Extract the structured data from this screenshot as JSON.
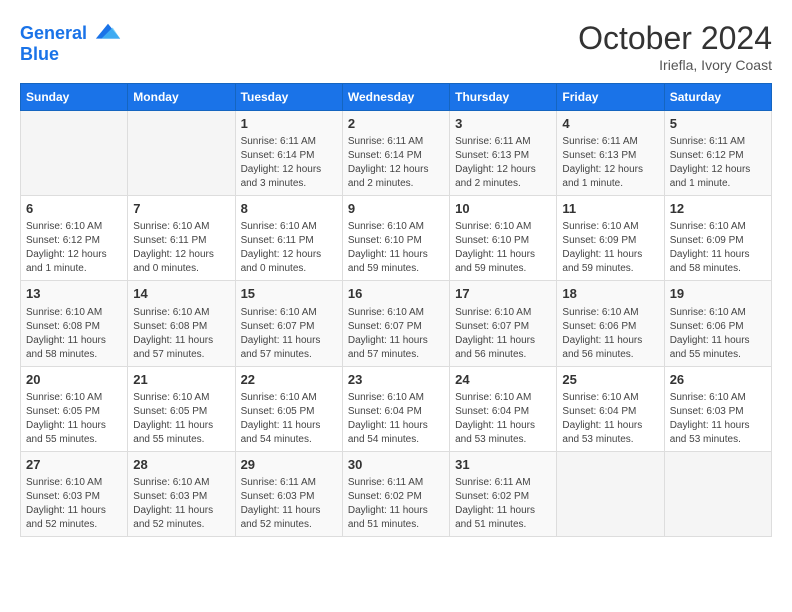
{
  "header": {
    "logo_line1": "General",
    "logo_line2": "Blue",
    "month": "October 2024",
    "location": "Iriefla, Ivory Coast"
  },
  "weekdays": [
    "Sunday",
    "Monday",
    "Tuesday",
    "Wednesday",
    "Thursday",
    "Friday",
    "Saturday"
  ],
  "weeks": [
    [
      {
        "day": "",
        "sunrise": "",
        "sunset": "",
        "daylight": ""
      },
      {
        "day": "",
        "sunrise": "",
        "sunset": "",
        "daylight": ""
      },
      {
        "day": "1",
        "sunrise": "Sunrise: 6:11 AM",
        "sunset": "Sunset: 6:14 PM",
        "daylight": "Daylight: 12 hours and 3 minutes."
      },
      {
        "day": "2",
        "sunrise": "Sunrise: 6:11 AM",
        "sunset": "Sunset: 6:14 PM",
        "daylight": "Daylight: 12 hours and 2 minutes."
      },
      {
        "day": "3",
        "sunrise": "Sunrise: 6:11 AM",
        "sunset": "Sunset: 6:13 PM",
        "daylight": "Daylight: 12 hours and 2 minutes."
      },
      {
        "day": "4",
        "sunrise": "Sunrise: 6:11 AM",
        "sunset": "Sunset: 6:13 PM",
        "daylight": "Daylight: 12 hours and 1 minute."
      },
      {
        "day": "5",
        "sunrise": "Sunrise: 6:11 AM",
        "sunset": "Sunset: 6:12 PM",
        "daylight": "Daylight: 12 hours and 1 minute."
      }
    ],
    [
      {
        "day": "6",
        "sunrise": "Sunrise: 6:10 AM",
        "sunset": "Sunset: 6:12 PM",
        "daylight": "Daylight: 12 hours and 1 minute."
      },
      {
        "day": "7",
        "sunrise": "Sunrise: 6:10 AM",
        "sunset": "Sunset: 6:11 PM",
        "daylight": "Daylight: 12 hours and 0 minutes."
      },
      {
        "day": "8",
        "sunrise": "Sunrise: 6:10 AM",
        "sunset": "Sunset: 6:11 PM",
        "daylight": "Daylight: 12 hours and 0 minutes."
      },
      {
        "day": "9",
        "sunrise": "Sunrise: 6:10 AM",
        "sunset": "Sunset: 6:10 PM",
        "daylight": "Daylight: 11 hours and 59 minutes."
      },
      {
        "day": "10",
        "sunrise": "Sunrise: 6:10 AM",
        "sunset": "Sunset: 6:10 PM",
        "daylight": "Daylight: 11 hours and 59 minutes."
      },
      {
        "day": "11",
        "sunrise": "Sunrise: 6:10 AM",
        "sunset": "Sunset: 6:09 PM",
        "daylight": "Daylight: 11 hours and 59 minutes."
      },
      {
        "day": "12",
        "sunrise": "Sunrise: 6:10 AM",
        "sunset": "Sunset: 6:09 PM",
        "daylight": "Daylight: 11 hours and 58 minutes."
      }
    ],
    [
      {
        "day": "13",
        "sunrise": "Sunrise: 6:10 AM",
        "sunset": "Sunset: 6:08 PM",
        "daylight": "Daylight: 11 hours and 58 minutes."
      },
      {
        "day": "14",
        "sunrise": "Sunrise: 6:10 AM",
        "sunset": "Sunset: 6:08 PM",
        "daylight": "Daylight: 11 hours and 57 minutes."
      },
      {
        "day": "15",
        "sunrise": "Sunrise: 6:10 AM",
        "sunset": "Sunset: 6:07 PM",
        "daylight": "Daylight: 11 hours and 57 minutes."
      },
      {
        "day": "16",
        "sunrise": "Sunrise: 6:10 AM",
        "sunset": "Sunset: 6:07 PM",
        "daylight": "Daylight: 11 hours and 57 minutes."
      },
      {
        "day": "17",
        "sunrise": "Sunrise: 6:10 AM",
        "sunset": "Sunset: 6:07 PM",
        "daylight": "Daylight: 11 hours and 56 minutes."
      },
      {
        "day": "18",
        "sunrise": "Sunrise: 6:10 AM",
        "sunset": "Sunset: 6:06 PM",
        "daylight": "Daylight: 11 hours and 56 minutes."
      },
      {
        "day": "19",
        "sunrise": "Sunrise: 6:10 AM",
        "sunset": "Sunset: 6:06 PM",
        "daylight": "Daylight: 11 hours and 55 minutes."
      }
    ],
    [
      {
        "day": "20",
        "sunrise": "Sunrise: 6:10 AM",
        "sunset": "Sunset: 6:05 PM",
        "daylight": "Daylight: 11 hours and 55 minutes."
      },
      {
        "day": "21",
        "sunrise": "Sunrise: 6:10 AM",
        "sunset": "Sunset: 6:05 PM",
        "daylight": "Daylight: 11 hours and 55 minutes."
      },
      {
        "day": "22",
        "sunrise": "Sunrise: 6:10 AM",
        "sunset": "Sunset: 6:05 PM",
        "daylight": "Daylight: 11 hours and 54 minutes."
      },
      {
        "day": "23",
        "sunrise": "Sunrise: 6:10 AM",
        "sunset": "Sunset: 6:04 PM",
        "daylight": "Daylight: 11 hours and 54 minutes."
      },
      {
        "day": "24",
        "sunrise": "Sunrise: 6:10 AM",
        "sunset": "Sunset: 6:04 PM",
        "daylight": "Daylight: 11 hours and 53 minutes."
      },
      {
        "day": "25",
        "sunrise": "Sunrise: 6:10 AM",
        "sunset": "Sunset: 6:04 PM",
        "daylight": "Daylight: 11 hours and 53 minutes."
      },
      {
        "day": "26",
        "sunrise": "Sunrise: 6:10 AM",
        "sunset": "Sunset: 6:03 PM",
        "daylight": "Daylight: 11 hours and 53 minutes."
      }
    ],
    [
      {
        "day": "27",
        "sunrise": "Sunrise: 6:10 AM",
        "sunset": "Sunset: 6:03 PM",
        "daylight": "Daylight: 11 hours and 52 minutes."
      },
      {
        "day": "28",
        "sunrise": "Sunrise: 6:10 AM",
        "sunset": "Sunset: 6:03 PM",
        "daylight": "Daylight: 11 hours and 52 minutes."
      },
      {
        "day": "29",
        "sunrise": "Sunrise: 6:11 AM",
        "sunset": "Sunset: 6:03 PM",
        "daylight": "Daylight: 11 hours and 52 minutes."
      },
      {
        "day": "30",
        "sunrise": "Sunrise: 6:11 AM",
        "sunset": "Sunset: 6:02 PM",
        "daylight": "Daylight: 11 hours and 51 minutes."
      },
      {
        "day": "31",
        "sunrise": "Sunrise: 6:11 AM",
        "sunset": "Sunset: 6:02 PM",
        "daylight": "Daylight: 11 hours and 51 minutes."
      },
      {
        "day": "",
        "sunrise": "",
        "sunset": "",
        "daylight": ""
      },
      {
        "day": "",
        "sunrise": "",
        "sunset": "",
        "daylight": ""
      }
    ]
  ]
}
